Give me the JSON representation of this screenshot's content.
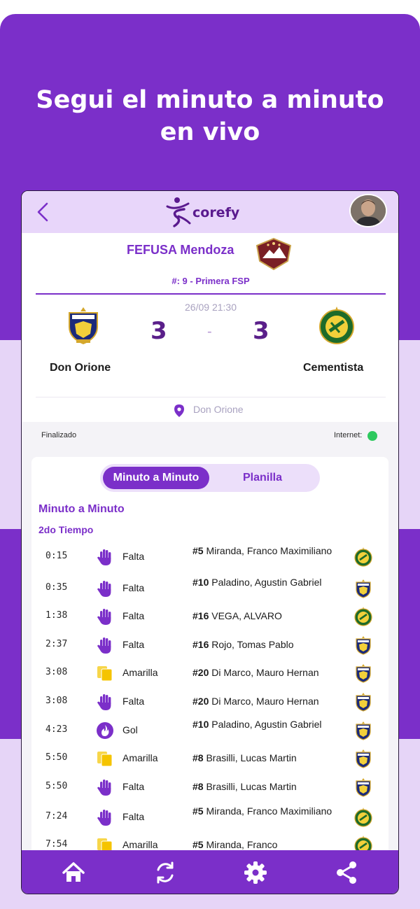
{
  "promo": {
    "headline_line1": "Segui el minuto a minuto",
    "headline_line2": "en vivo"
  },
  "topbar": {
    "brand": "corefy"
  },
  "match": {
    "league": "FEFUSA Mendoza",
    "round": "#: 9 - Primera FSP",
    "datetime": "26/09 21:30",
    "home_team": "Don Orione",
    "away_team": "Cementista",
    "home_score": "3",
    "away_score": "3",
    "separator": "-",
    "venue": "Don Orione",
    "status": "Finalizado",
    "internet_label": "Internet:"
  },
  "tabs": {
    "active": "Minuto a Minuto",
    "other": "Planilla"
  },
  "section": {
    "title": "Minuto a Minuto",
    "half": "2do Tiempo"
  },
  "events": [
    {
      "minute": "0:15",
      "type": "Falta",
      "number": "#5",
      "player": "Miranda, Franco Maximiliano",
      "team": "away",
      "icon": "hand-icon"
    },
    {
      "minute": "0:35",
      "type": "Falta",
      "number": "#10",
      "player": "Paladino, Agustin Gabriel",
      "team": "home",
      "icon": "hand-icon"
    },
    {
      "minute": "1:38",
      "type": "Falta",
      "number": "#16",
      "player": "VEGA, ALVARO",
      "team": "away",
      "icon": "hand-icon"
    },
    {
      "minute": "2:37",
      "type": "Falta",
      "number": "#16",
      "player": "Rojo, Tomas Pablo",
      "team": "home",
      "icon": "hand-icon"
    },
    {
      "minute": "3:08",
      "type": "Amarilla",
      "number": "#20",
      "player": "Di Marco, Mauro Hernan",
      "team": "home",
      "icon": "yellow-card-icon"
    },
    {
      "minute": "3:08",
      "type": "Falta",
      "number": "#20",
      "player": "Di Marco, Mauro Hernan",
      "team": "home",
      "icon": "hand-icon"
    },
    {
      "minute": "4:23",
      "type": "Gol",
      "number": "#10",
      "player": "Paladino, Agustin Gabriel",
      "team": "home",
      "icon": "goal-icon"
    },
    {
      "minute": "5:50",
      "type": "Amarilla",
      "number": "#8",
      "player": "Brasilli, Lucas Martin",
      "team": "home",
      "icon": "yellow-card-icon"
    },
    {
      "minute": "5:50",
      "type": "Falta",
      "number": "#8",
      "player": "Brasilli, Lucas Martin",
      "team": "home",
      "icon": "hand-icon"
    },
    {
      "minute": "7:24",
      "type": "Falta",
      "number": "#5",
      "player": "Miranda, Franco Maximiliano",
      "team": "away",
      "icon": "hand-icon"
    },
    {
      "minute": "7:54",
      "type": "Amarilla",
      "number": "#5",
      "player": "Miranda, Franco",
      "team": "away",
      "icon": "yellow-card-icon"
    }
  ],
  "nav": [
    "home-icon",
    "refresh-icon",
    "gear-icon",
    "share-icon"
  ],
  "colors": {
    "brand": "#7b2fc9",
    "light": "#e6d5f7",
    "status_ok": "#2ec95f",
    "card": "#f5c400"
  }
}
